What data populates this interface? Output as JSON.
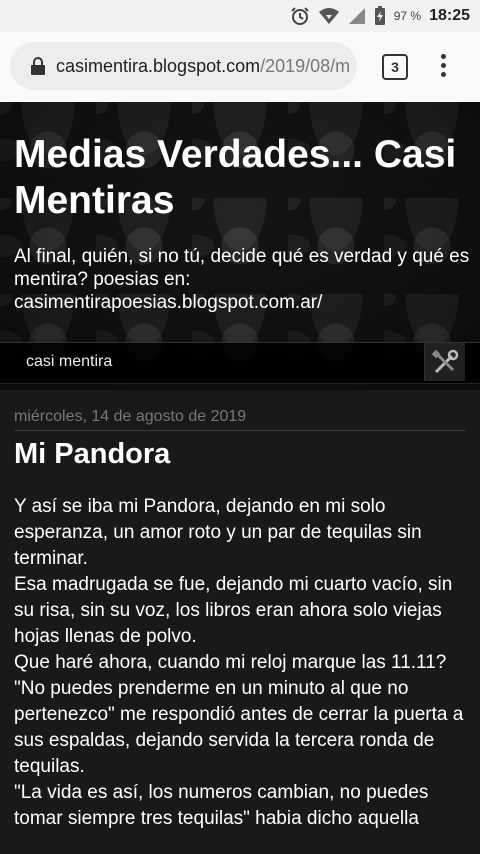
{
  "status": {
    "battery": "97 %",
    "time": "18:25",
    "icons": [
      "alarm-icon",
      "wifi-icon",
      "signal-icon",
      "battery-charging-icon"
    ]
  },
  "browser": {
    "url_host": "casimentira.blogspot.com",
    "url_path": "/2019/08/m",
    "tab_count": "3"
  },
  "blog": {
    "title": "Medias Verdades... Casi Mentiras",
    "description": "Al final, quién, si no tú, decide qué es verdad y qué es mentira? poesias en: casimentirapoesias.blogspot.com.ar/",
    "nav_label": "casi mentira"
  },
  "post": {
    "date": "miércoles, 14 de agosto de 2019",
    "title": "Mi Pandora",
    "paragraphs": [
      "Y así se iba mi Pandora, dejando en mi solo esperanza, un amor roto y un par de tequilas sin terminar.",
      "Esa madrugada se fue, dejando mi cuarto vacío, sin su risa, sin su voz, los libros eran ahora solo viejas hojas llenas de polvo.",
      "Que haré ahora, cuando mi reloj marque las 11.11?",
      "\"No puedes prenderme en un minuto al que no pertenezco\" me respondió antes de cerrar la puerta a sus espaldas, dejando servida la tercera ronda de tequilas.",
      "\"La vida es así, los numeros cambian, no puedes tomar siempre tres tequilas\" habia dicho aquella"
    ]
  },
  "colors": {
    "page_bg": "#1b1b1b",
    "text": "#ffffff",
    "date": "#777777"
  }
}
